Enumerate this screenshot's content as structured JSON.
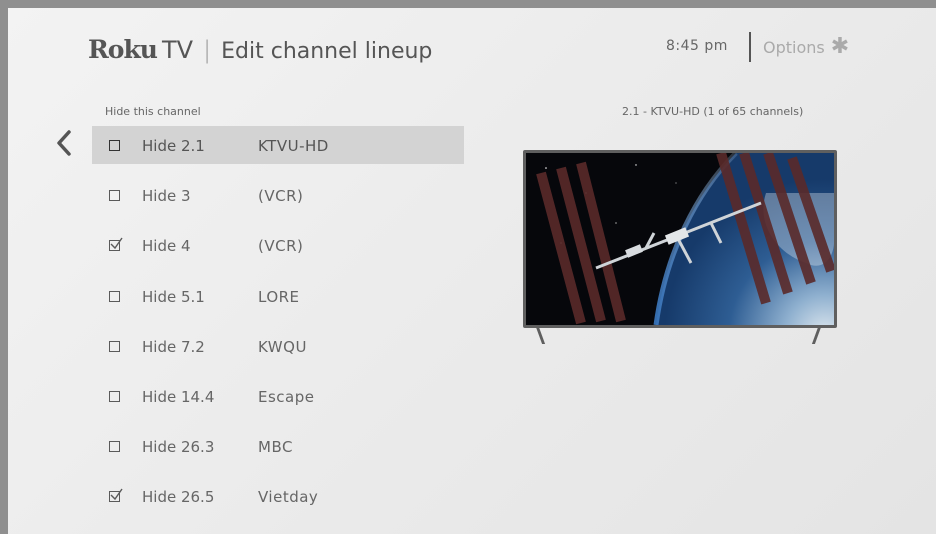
{
  "header": {
    "brand_roku": "Roku",
    "brand_tv": "TV",
    "separator": "|",
    "title": "Edit channel lineup",
    "time": "8:45 pm",
    "options_label": "Options",
    "options_glyph": "✱"
  },
  "list": {
    "column_header": "Hide this channel",
    "channel_info": "2.1 - KTVU-HD (1 of 65 channels)",
    "rows": [
      {
        "hide": "Hide 2.1",
        "name": "KTVU-HD",
        "checked": false
      },
      {
        "hide": "Hide 3",
        "name": "(VCR)",
        "checked": false
      },
      {
        "hide": "Hide 4",
        "name": "(VCR)",
        "checked": true
      },
      {
        "hide": "Hide 5.1",
        "name": "LORE",
        "checked": false
      },
      {
        "hide": "Hide 7.2",
        "name": "KWQU",
        "checked": false
      },
      {
        "hide": "Hide 14.4",
        "name": "Escape",
        "checked": false
      },
      {
        "hide": "Hide 26.3",
        "name": "MBC",
        "checked": false
      },
      {
        "hide": "Hide 26.5",
        "name": "Vietday",
        "checked": true
      }
    ]
  },
  "icons": {
    "back": "chevron-left-icon",
    "options": "asterisk-icon",
    "checkbox": "checkbox-icon"
  },
  "colors": {
    "background": "#ececec",
    "highlight": "#d3d3d3",
    "text": "#666666",
    "tv_frame": "#5f5f5f"
  }
}
